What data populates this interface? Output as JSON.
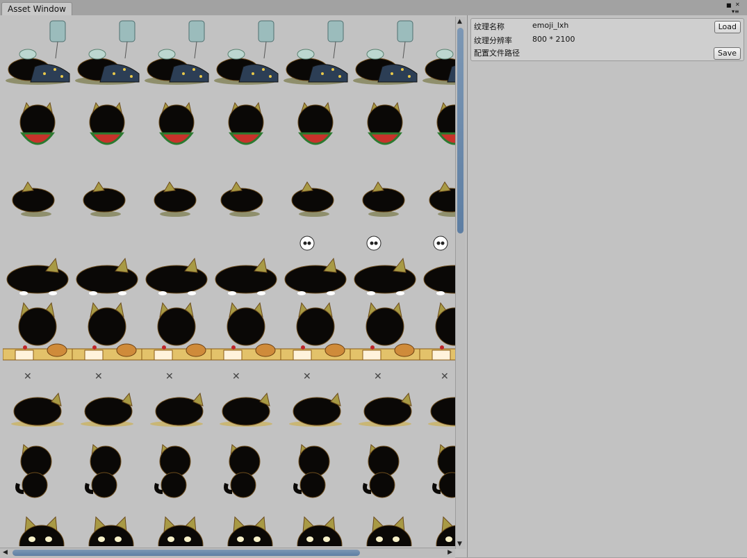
{
  "window": {
    "tab_title": "Asset Window",
    "menu_icons": [
      "restore-icon",
      "menu-icon"
    ]
  },
  "panel": {
    "texture_name_label": "纹理名称",
    "texture_name_value": "emoji_lxh",
    "resolution_label": "纹理分辨率",
    "resolution_value": "800 * 2100",
    "config_path_label": "配置文件路径",
    "load_button": "Load",
    "save_button": "Save"
  },
  "sprite_grid": {
    "columns": 7,
    "visible_rows": 8,
    "row_themes": [
      "sick-bed",
      "watermelon",
      "lying",
      "sleeping-skull",
      "feast",
      "defeated",
      "sitting",
      "peeking"
    ]
  },
  "colors": {
    "cat": "#0a0806",
    "cat_outline": "#6b4b1b",
    "ear": "#a89a45",
    "accent_blue": "#5d7ea3"
  }
}
